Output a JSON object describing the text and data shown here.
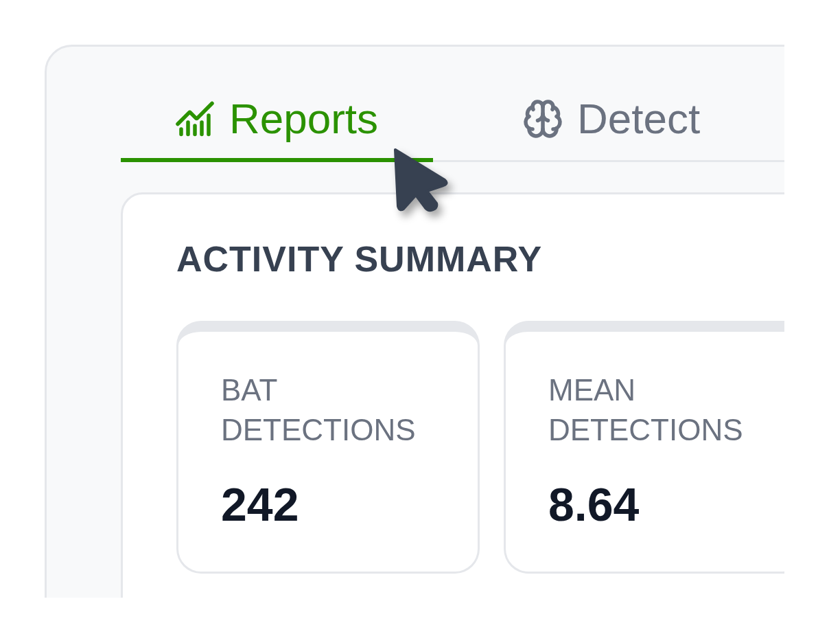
{
  "tabs": [
    {
      "label": "Reports",
      "selected": true
    },
    {
      "label": "Detect",
      "selected": false
    }
  ],
  "activity_summary": {
    "title": "ACTIVITY SUMMARY",
    "stats": [
      {
        "label": "BAT DETECTIONS",
        "value": "242"
      },
      {
        "label": "MEAN DETECTIONS",
        "value": "8.64"
      }
    ]
  }
}
